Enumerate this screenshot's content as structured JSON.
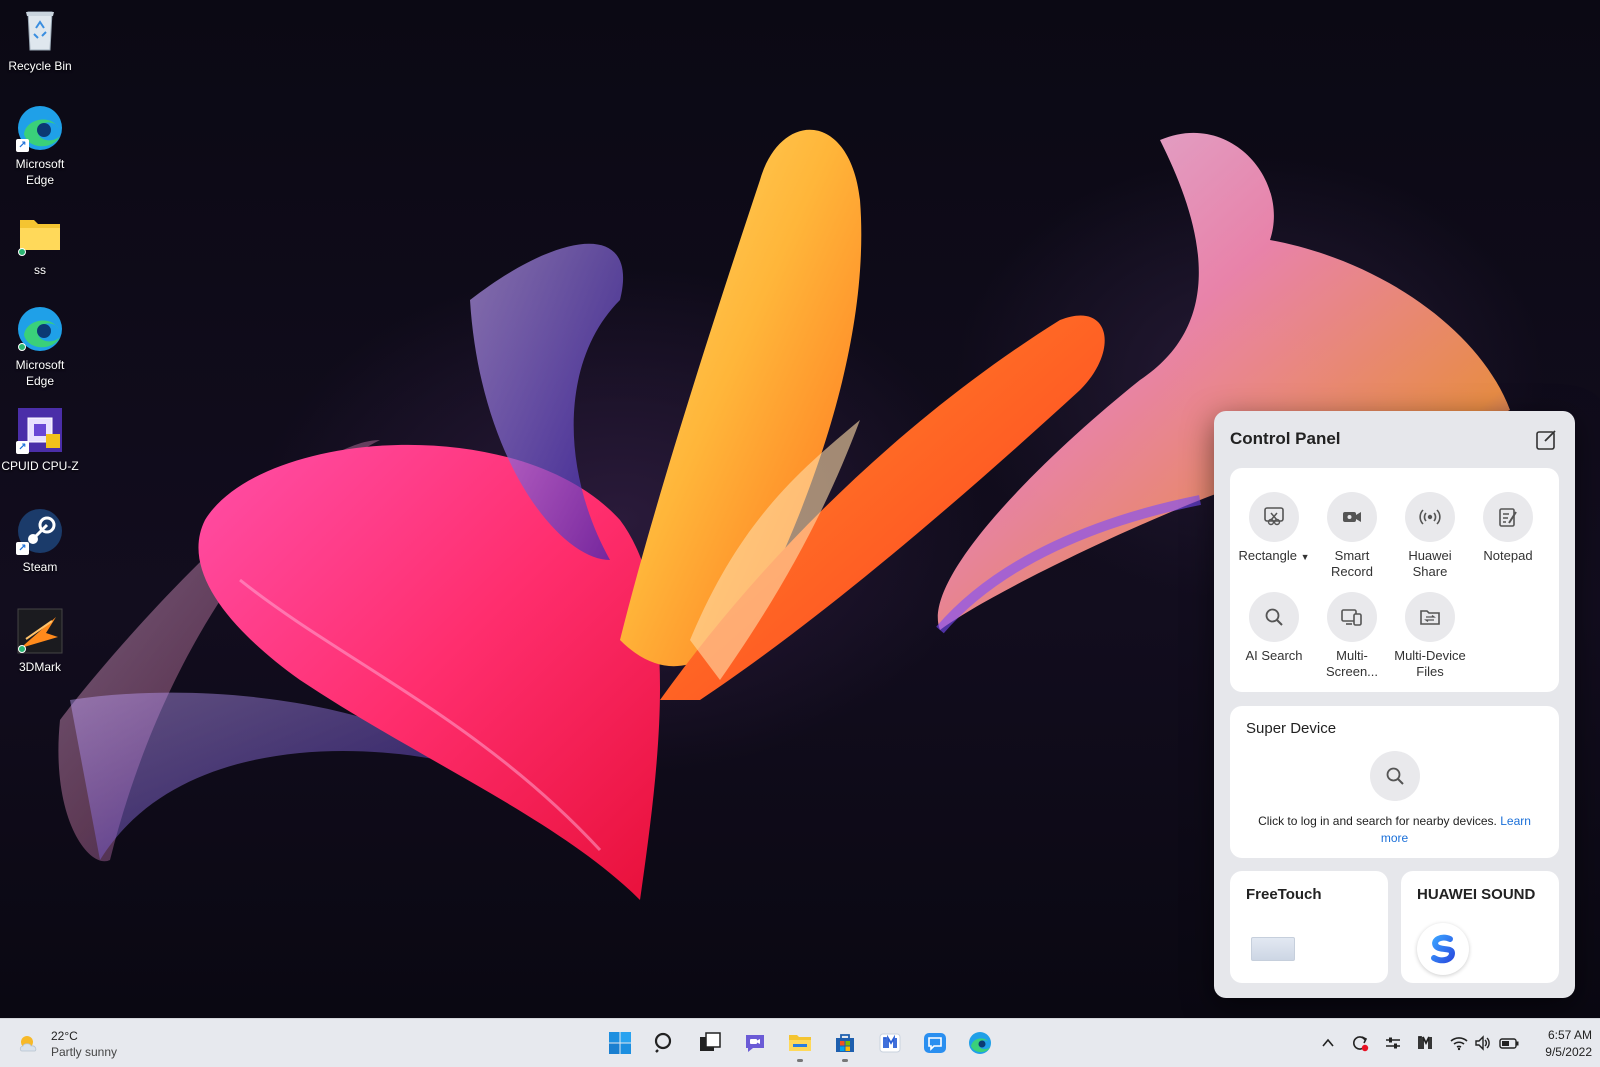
{
  "desktop": {
    "icons": [
      {
        "label": "Recycle Bin",
        "icon": "recycle-bin-icon"
      },
      {
        "label": "Microsoft Edge",
        "icon": "edge-icon"
      },
      {
        "label": "ss",
        "icon": "folder-icon"
      },
      {
        "label": "Microsoft Edge",
        "icon": "edge-icon"
      },
      {
        "label": "CPUID CPU-Z",
        "icon": "cpuz-icon"
      },
      {
        "label": "Steam",
        "icon": "steam-icon"
      },
      {
        "label": "3DMark",
        "icon": "3dmark-icon"
      }
    ]
  },
  "control_panel": {
    "title": "Control Panel",
    "tools": [
      {
        "label": "Rectangle",
        "icon": "screenshot-icon",
        "has_dropdown": true
      },
      {
        "label": "Smart Record",
        "icon": "video-camera-icon"
      },
      {
        "label": "Huawei Share",
        "icon": "wireless-share-icon"
      },
      {
        "label": "Notepad",
        "icon": "notepad-icon"
      },
      {
        "label": "AI Search",
        "icon": "search-icon"
      },
      {
        "label": "Multi-Screen...",
        "icon": "multi-screen-icon"
      },
      {
        "label": "Multi-Device Files",
        "icon": "multi-device-files-icon"
      }
    ],
    "super_device": {
      "title": "Super Device",
      "text": "Click to log in and search for nearby devices.",
      "link": "Learn more"
    },
    "freetouch": {
      "title": "FreeTouch"
    },
    "huawei_sound": {
      "title": "HUAWEI SOUND"
    }
  },
  "taskbar": {
    "weather": {
      "temp": "22°C",
      "desc": "Partly sunny",
      "icon": "partly-sunny-icon"
    },
    "apps": [
      {
        "name": "start",
        "icon": "windows-start-icon"
      },
      {
        "name": "search",
        "icon": "search-icon"
      },
      {
        "name": "task-view",
        "icon": "task-view-icon"
      },
      {
        "name": "teams-chat",
        "icon": "chat-icon"
      },
      {
        "name": "file-explorer",
        "icon": "file-explorer-icon",
        "running": true
      },
      {
        "name": "microsoft-store",
        "icon": "store-icon",
        "running": true
      },
      {
        "name": "huawei-pc-manager",
        "icon": "pc-manager-icon"
      },
      {
        "name": "messages",
        "icon": "message-icon"
      },
      {
        "name": "edge",
        "icon": "edge-icon"
      }
    ],
    "tray": [
      "chevron-up-icon",
      "sync-alert-icon",
      "settings-toggle-icon",
      "pc-manager-tray-icon",
      "wifi-icon",
      "volume-icon",
      "battery-icon"
    ],
    "clock": {
      "time": "6:57 AM",
      "date": "9/5/2022"
    }
  }
}
